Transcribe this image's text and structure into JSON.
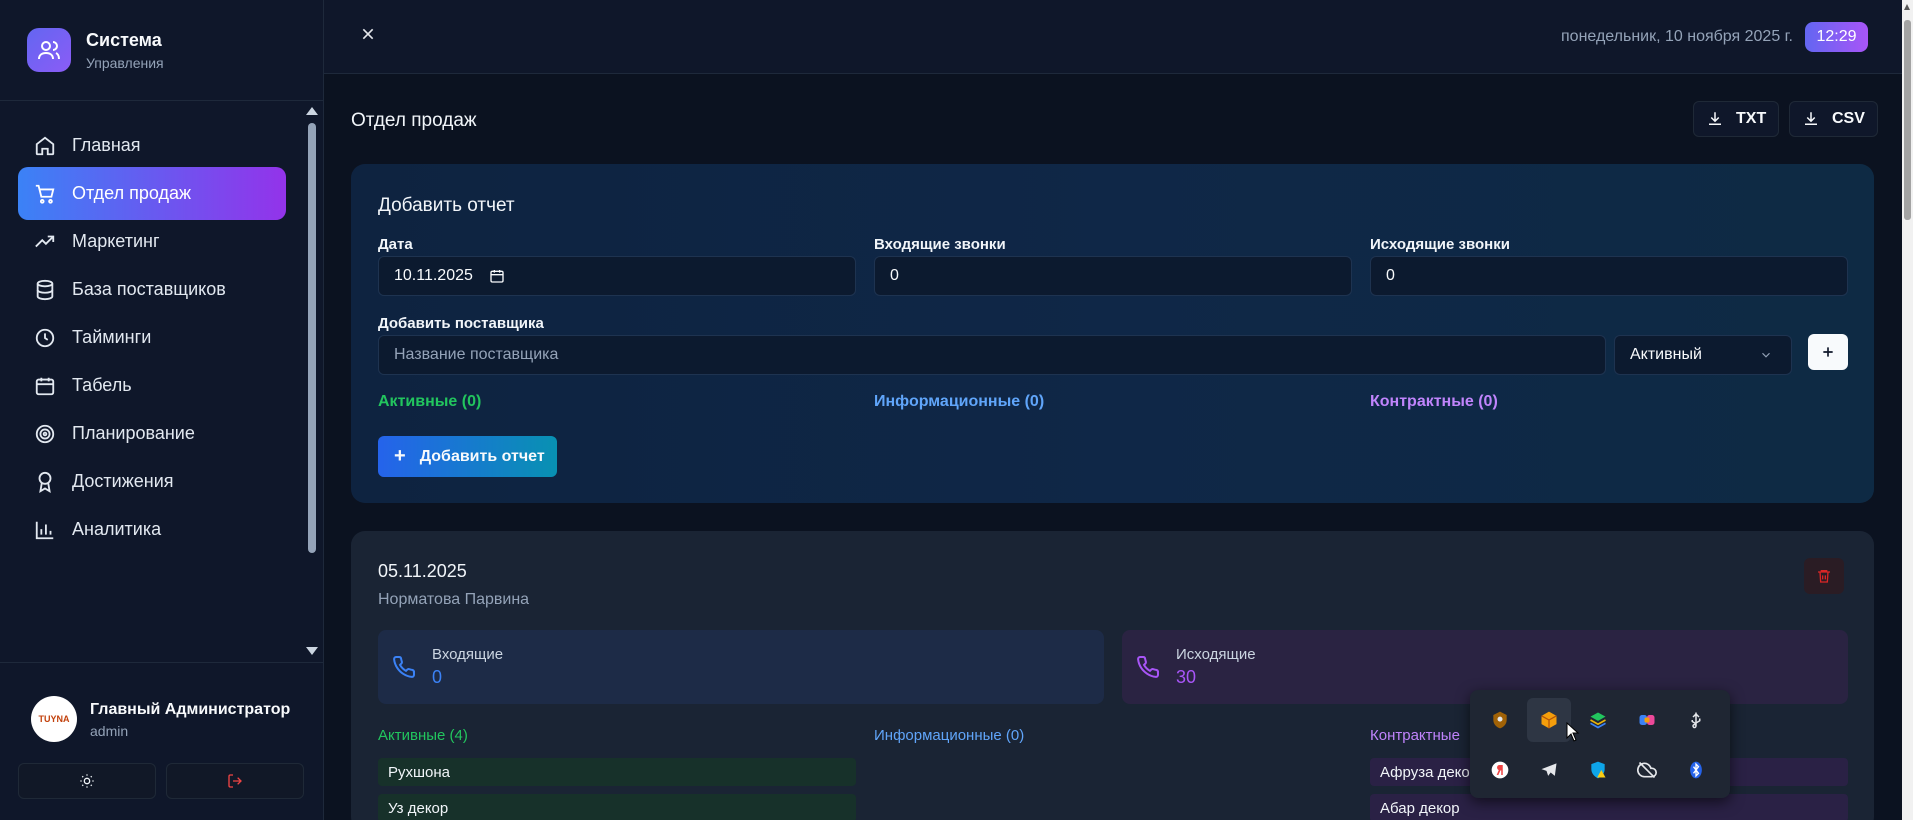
{
  "brand": {
    "title": "Система",
    "subtitle": "Управления"
  },
  "sidebar": {
    "items": [
      {
        "label": "Главная",
        "icon": "home-icon"
      },
      {
        "label": "Отдел продаж",
        "icon": "cart-icon",
        "active": true
      },
      {
        "label": "Маркетинг",
        "icon": "trending-up-icon"
      },
      {
        "label": "База поставщиков",
        "icon": "database-icon"
      },
      {
        "label": "Тайминги",
        "icon": "clock-icon"
      },
      {
        "label": "Табель",
        "icon": "calendar-icon"
      },
      {
        "label": "Планирование",
        "icon": "target-icon"
      },
      {
        "label": "Достижения",
        "icon": "award-icon"
      },
      {
        "label": "Аналитика",
        "icon": "bar-chart-icon"
      }
    ]
  },
  "user": {
    "name": "Главный Администратор",
    "role": "admin",
    "avatar_text": "TUYNA"
  },
  "topbar": {
    "date": "понедельник, 10 ноября 2025 г.",
    "time": "12:29"
  },
  "page": {
    "title": "Отдел продаж",
    "export_txt": "TXT",
    "export_csv": "CSV"
  },
  "add_report": {
    "title": "Добавить отчет",
    "date_label": "Дата",
    "date_value": "10.11.2025",
    "incoming_label": "Входящие звонки",
    "incoming_value": "0",
    "outgoing_label": "Исходящие звонки",
    "outgoing_value": "0",
    "supplier_label": "Добавить поставщика",
    "supplier_placeholder": "Название поставщика",
    "status_value": "Активный",
    "active_count": "Активные (0)",
    "info_count": "Информационные (0)",
    "contract_count": "Контрактные (0)",
    "submit_label": "Добавить отчет"
  },
  "report": {
    "date": "05.11.2025",
    "name": "Норматова Парвина",
    "incoming_label": "Входящие",
    "incoming_value": "0",
    "outgoing_label": "Исходящие",
    "outgoing_value": "30",
    "active_label": "Активные (4)",
    "info_label": "Информационные (0)",
    "contract_label": "Контрактные",
    "active_items": [
      "Рухшона",
      "Уз декор"
    ],
    "contract_items": [
      "Афруза деко",
      "Абар декор"
    ]
  },
  "colors": {
    "accent_start": "#3b82f6",
    "accent_end": "#9333ea",
    "green": "#22c55e",
    "blue": "#60a5fa",
    "purple": "#c084fc"
  }
}
